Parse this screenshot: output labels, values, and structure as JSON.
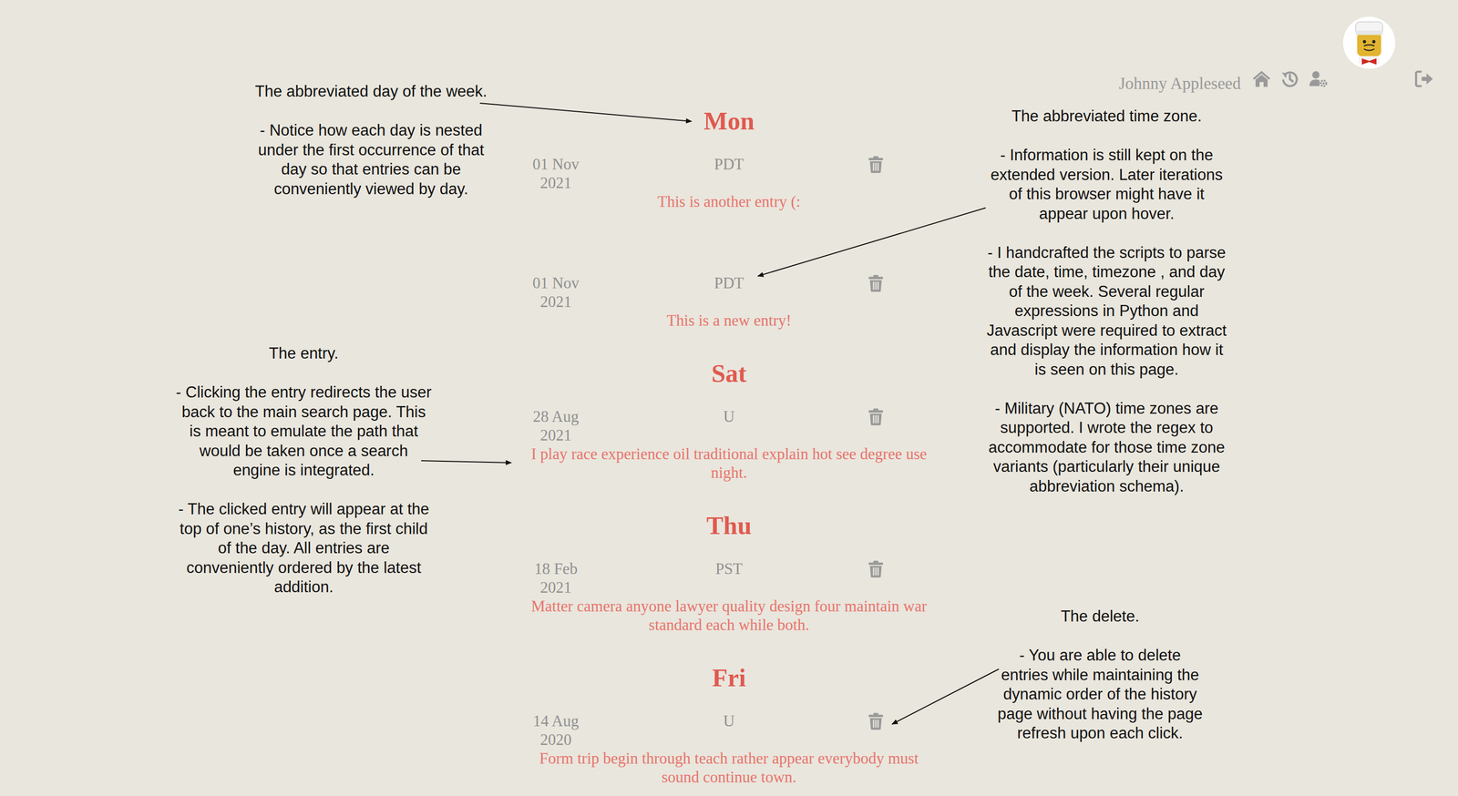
{
  "header": {
    "user_name": "Johnny Appleseed"
  },
  "days": [
    {
      "day": "Mon",
      "entries": [
        {
          "date": "01 Nov",
          "year": "2021",
          "tz": "PDT",
          "text": "This is another entry (:"
        },
        {
          "date": "01 Nov",
          "year": "2021",
          "tz": "PDT",
          "text": "This is a new entry!"
        }
      ]
    },
    {
      "day": "Sat",
      "entries": [
        {
          "date": "28 Aug",
          "year": "2021",
          "tz": "U",
          "text": "I play race experience oil traditional explain hot see degree use night."
        }
      ]
    },
    {
      "day": "Thu",
      "entries": [
        {
          "date": "18 Feb",
          "year": "2021",
          "tz": "PST",
          "text": "Matter camera anyone lawyer quality design four maintain war standard each while both."
        }
      ]
    },
    {
      "day": "Fri",
      "entries": [
        {
          "date": "14 Aug",
          "year": "2020",
          "tz": "U",
          "text": "Form trip begin through teach rather appear everybody must sound continue town."
        }
      ]
    }
  ],
  "annotations": [
    {
      "title": "The abbreviated day of the week.",
      "notes": [
        "- Notice how each day is nested under the first occurrence of that day so that entries can be conveniently viewed by day."
      ]
    },
    {
      "title": "The entry.",
      "notes": [
        "- Clicking the entry redirects the user back to the main search page. This is meant to emulate the path that would be taken once a search engine is integrated.",
        "- The clicked entry will appear at the top of one’s history, as the first child of the day. All entries are conveniently ordered by the latest addition."
      ]
    },
    {
      "title": "The abbreviated time zone.",
      "notes": [
        "- Information is still kept on the extended version. Later iterations of this browser might have it appear upon hover.",
        "- I handcrafted the scripts to parse the date, time, timezone , and day of the week. Several regular expressions in Python and Javascript were required to extract and display the information how it is seen on this page.",
        "- Military (NATO) time zones are supported. I wrote the regex to accommodate for those time zone variants (particularly their unique abbreviation schema)."
      ]
    },
    {
      "title": "The delete.",
      "notes": [
        "- You are able to delete entries while maintaining the dynamic order of the history page without having the page refresh upon each click."
      ]
    }
  ]
}
